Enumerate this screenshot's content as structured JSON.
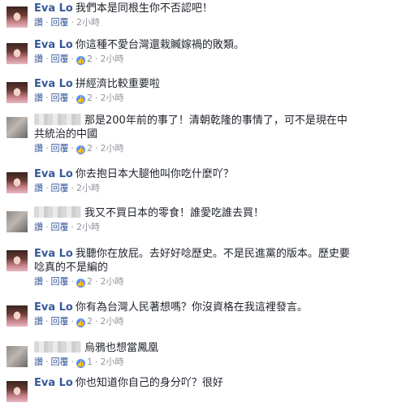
{
  "actions": {
    "like": "讚",
    "reply": "回覆",
    "separator": "·"
  },
  "comments": [
    {
      "author": "Eva Lo",
      "anonymous": false,
      "lines": [
        "我們本是同根生你不否認吧！"
      ],
      "time": "2小時",
      "likes": ""
    },
    {
      "author": "Eva Lo",
      "anonymous": false,
      "lines": [
        "你這種不愛台灣還栽贓嫁禍的敗類。"
      ],
      "time": "2小時",
      "likes": "2"
    },
    {
      "author": "Eva Lo",
      "anonymous": false,
      "lines": [
        "拼經濟比較重要啦"
      ],
      "time": "2小時",
      "likes": "2"
    },
    {
      "author": "",
      "anonymous": true,
      "lines": [
        "那是200年前的事了！清朝乾隆的事情了，可不是現在中",
        "共統治的中國"
      ],
      "time": "2小時",
      "likes": "2"
    },
    {
      "author": "Eva Lo",
      "anonymous": false,
      "lines": [
        "你去抱日本大腿他叫你吃什麼吖？"
      ],
      "time": "2小時",
      "likes": ""
    },
    {
      "author": "",
      "anonymous": true,
      "lines": [
        "我又不買日本的零食！誰愛吃誰去買！"
      ],
      "time": "2小時",
      "likes": ""
    },
    {
      "author": "Eva Lo",
      "anonymous": false,
      "lines": [
        "我聽你在放屁。去好好唸歷史。不是民進黨的版本。歷史要",
        "唸真的不是編的"
      ],
      "time": "2小時",
      "likes": "2"
    },
    {
      "author": "Eva Lo",
      "anonymous": false,
      "lines": [
        "你有為台灣人民著想嗎？你沒資格在我這裡發言。"
      ],
      "time": "2小時",
      "likes": "2"
    },
    {
      "author": "",
      "anonymous": true,
      "lines": [
        "烏鴉也想當鳳凰"
      ],
      "time": "2小時",
      "likes": "1"
    },
    {
      "author": "Eva Lo",
      "anonymous": false,
      "lines": [
        "你也知道你自己的身分吖？很好"
      ],
      "time": "",
      "likes": ""
    }
  ]
}
